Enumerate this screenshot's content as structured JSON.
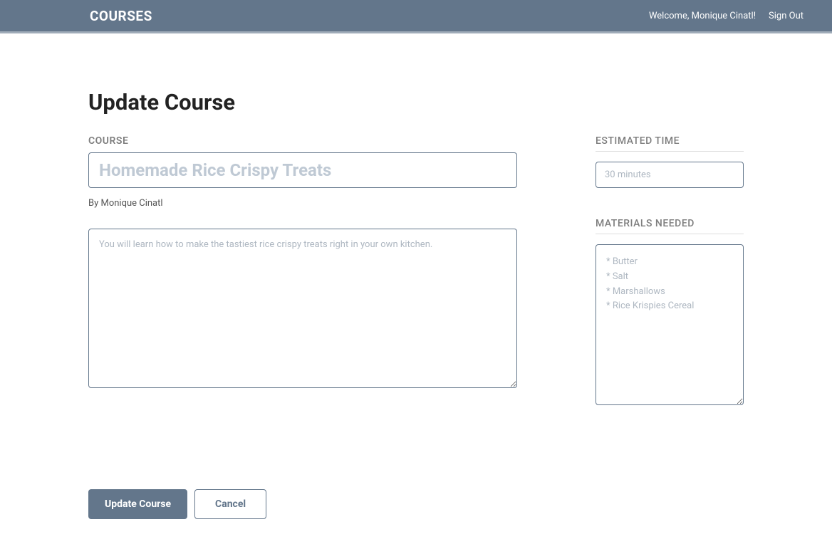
{
  "header": {
    "title": "COURSES",
    "welcome": "Welcome, Monique Cinatl!",
    "signout": "Sign Out"
  },
  "page": {
    "title": "Update Course"
  },
  "labels": {
    "course": "COURSE",
    "estimated_time": "ESTIMATED TIME",
    "materials": "MATERIALS NEEDED"
  },
  "form": {
    "title_placeholder": "Homemade Rice Crispy Treats",
    "byline": "By Monique Cinatl",
    "description_placeholder": "You will learn how to make the tastiest rice crispy treats right in your own kitchen.",
    "time_placeholder": "30 minutes",
    "materials_placeholder": "* Butter\n* Salt\n* Marshallows\n* Rice Krispies Cereal"
  },
  "buttons": {
    "update": "Update Course",
    "cancel": "Cancel"
  }
}
